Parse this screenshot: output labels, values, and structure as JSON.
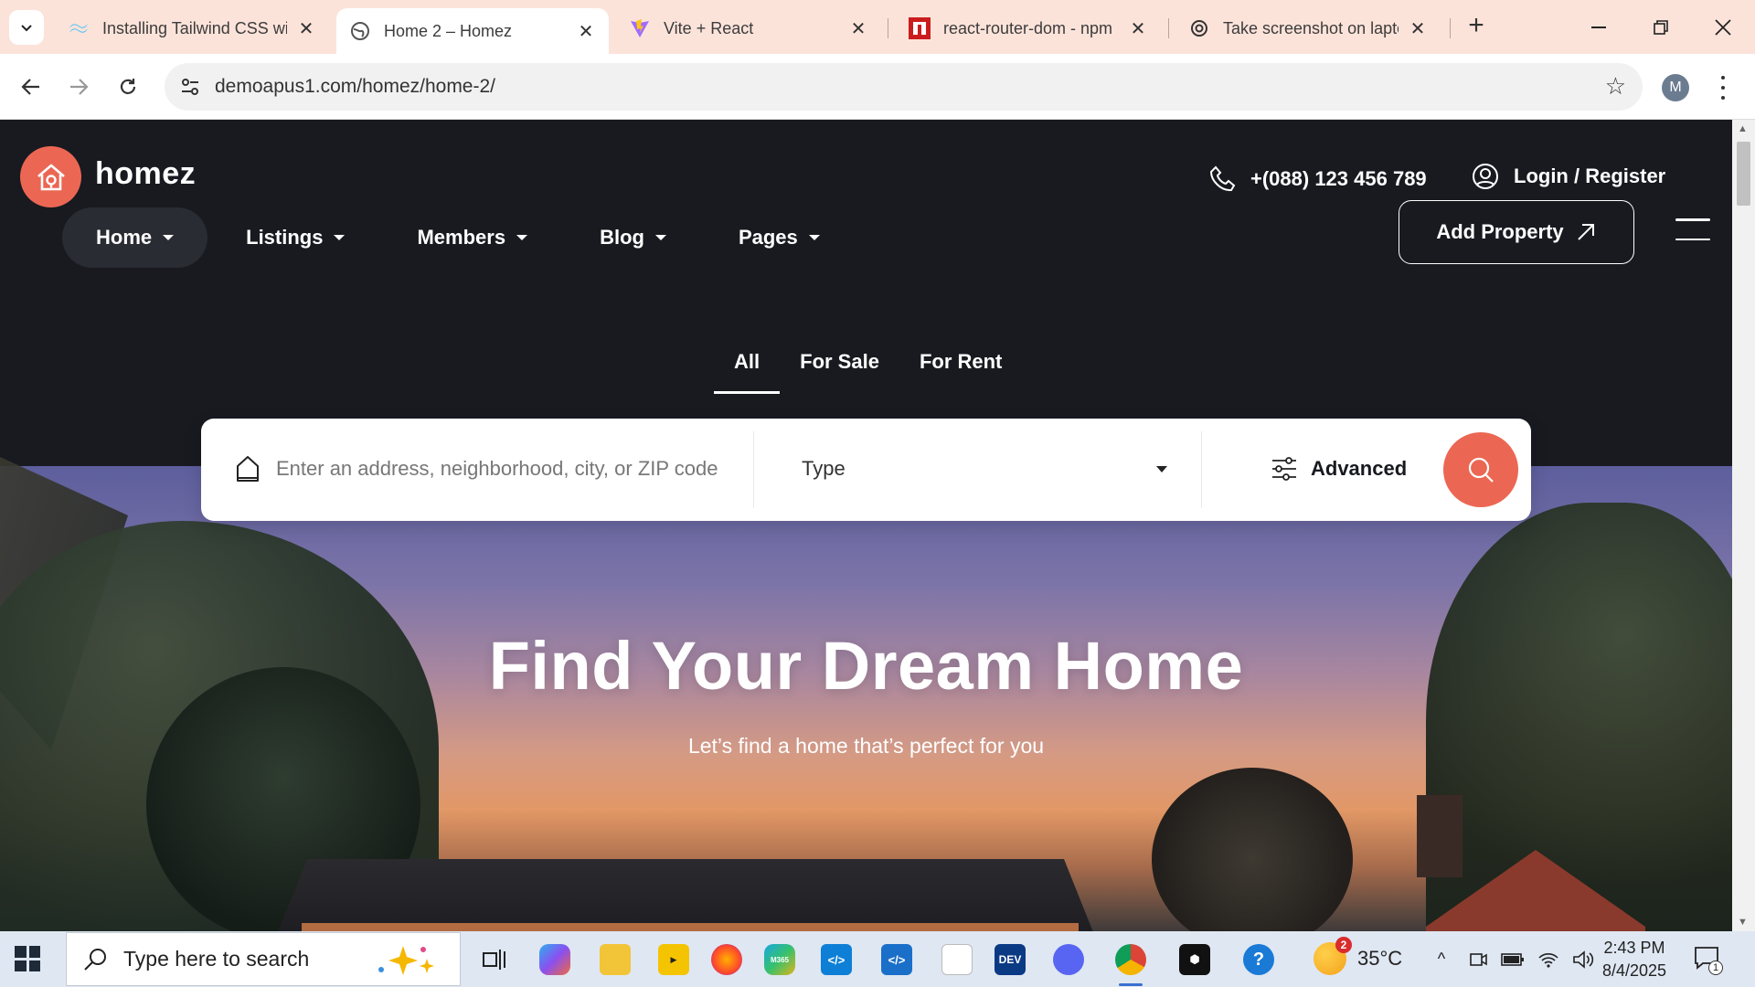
{
  "browser": {
    "tabs": [
      {
        "title": "Installing Tailwind CSS wi",
        "icon": "tailwind-icon",
        "active": false
      },
      {
        "title": "Home 2 – Homez",
        "icon": "globe-icon",
        "active": true
      },
      {
        "title": "Vite + React",
        "icon": "vite-icon",
        "active": false
      },
      {
        "title": "react-router-dom - npm",
        "icon": "npm-icon",
        "active": false
      },
      {
        "title": "Take screenshot on lapto",
        "icon": "chatgpt-icon",
        "active": false
      }
    ],
    "url": "demoapus1.com/homez/home-2/",
    "profile_initial": "M"
  },
  "site": {
    "brand": "homez",
    "phone": "+(088) 123 456 789",
    "login": "Login / Register",
    "add_property": "Add Property",
    "nav": [
      {
        "label": "Home",
        "active": true
      },
      {
        "label": "Listings",
        "active": false
      },
      {
        "label": "Members",
        "active": false
      },
      {
        "label": "Blog",
        "active": false
      },
      {
        "label": "Pages",
        "active": false
      }
    ],
    "search_tabs": [
      {
        "label": "All",
        "active": true
      },
      {
        "label": "For Sale",
        "active": false
      },
      {
        "label": "For Rent",
        "active": false
      }
    ],
    "search": {
      "placeholder": "Enter an address, neighborhood, city, or ZIP code",
      "type_label": "Type",
      "advanced_label": "Advanced"
    },
    "hero": {
      "title": "Find Your Dream Home",
      "subtitle": "Let’s find a home that’s perfect for you"
    },
    "colors": {
      "accent": "#eb6753",
      "dark_bg": "#181a20"
    }
  },
  "taskbar": {
    "search_placeholder": "Type here to search",
    "weather_temp": "35°C",
    "weather_badge": "2",
    "time": "2:43 PM",
    "date": "8/4/2025",
    "notification_count": "1"
  }
}
